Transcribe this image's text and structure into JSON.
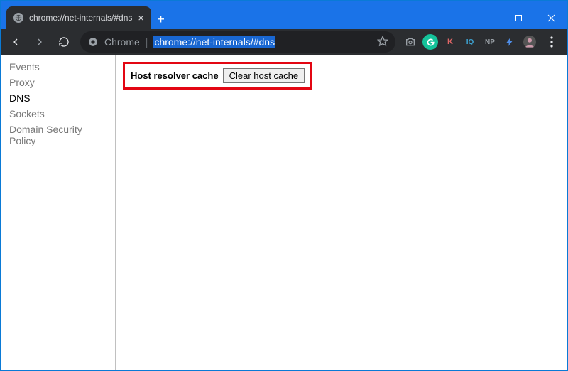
{
  "window": {
    "tab_title": "chrome://net-internals/#dns"
  },
  "toolbar": {
    "chrome_label": "Chrome",
    "url": "chrome://net-internals/#dns"
  },
  "extensions": {
    "k_label": "K",
    "iq_label": "IQ",
    "np_label": "NP"
  },
  "sidebar": {
    "items": [
      {
        "label": "Events",
        "active": false
      },
      {
        "label": "Proxy",
        "active": false
      },
      {
        "label": "DNS",
        "active": true
      },
      {
        "label": "Sockets",
        "active": false
      },
      {
        "label": "Domain Security Policy",
        "active": false
      }
    ]
  },
  "main": {
    "section_label": "Host resolver cache",
    "clear_button_label": "Clear host cache"
  }
}
